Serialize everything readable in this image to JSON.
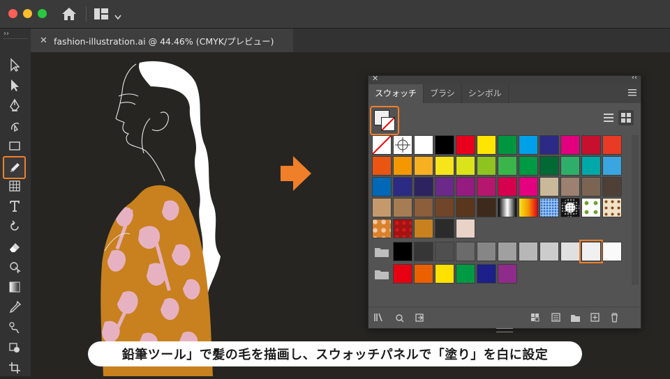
{
  "window": {
    "traffic_lights": {
      "close": "#ff5f57",
      "minimize": "#febc2e",
      "zoom": "#28c840"
    },
    "icons": [
      "home-icon",
      "workspace-layout-icon",
      "chevron-down-icon"
    ]
  },
  "document_tab": {
    "close_label": "✕",
    "title": "fashion-illustration.ai @ 44.46% (CMYK/プレビュー)"
  },
  "toolbar": {
    "collapse_label": "››",
    "tools": [
      "selection-tool",
      "direct-selection-tool",
      "pen-tool",
      "curvature-tool",
      "rectangle-tool",
      "pencil-tool",
      "artboard-grid-tool",
      "type-tool",
      "rotate-tool",
      "eraser-tool",
      "shape-builder-tool",
      "gradient-tool",
      "eyedropper-tool",
      "blend-tool",
      "live-paint-tool",
      "crop-tool"
    ],
    "active_tool": "pencil-tool",
    "accent": "#f07f2a"
  },
  "swatches_panel": {
    "close_label": "✕",
    "collapse_label": "‹‹",
    "tabs": [
      {
        "label": "スウォッチ",
        "active": true
      },
      {
        "label": "ブラシ",
        "active": false
      },
      {
        "label": "シンボル",
        "active": false
      }
    ],
    "menu_icon": "panel-menu-icon",
    "view_modes": [
      "list-view-icon",
      "thumbnail-view-icon"
    ],
    "fill_color": "#efefef",
    "rows": [
      [
        "none",
        "registration",
        "#ffffff",
        "#000000",
        "#e8001c",
        "#ffe500",
        "#00963f",
        "#00a0e9",
        "#2b2a87",
        "#e3007f",
        "#c7102e",
        "#e83a27"
      ],
      [
        "#ea5513",
        "#f39800",
        "#f5b122",
        "#f6e51b",
        "#dbe31b",
        "#8fc31f",
        "#3ab54a",
        "#009944",
        "#006934",
        "#2fae6a",
        "#00a9a7",
        "#3aa5de"
      ],
      [
        "#0068b7",
        "#2b2b83",
        "#2e2361",
        "#6b2a89",
        "#951b81",
        "#b4176d",
        "#d7004f",
        "#e4007f",
        "#c9b89a",
        "#9c8170",
        "#7b6552",
        "#4f4037"
      ],
      [
        "#c49a6c",
        "#a67c52",
        "#8b5e3c",
        "#704628",
        "#5a361c",
        "#3e2a1a",
        "grad-bw",
        "grad-orange",
        "grad-blue-dots",
        "pattern-dots",
        "pattern-leaf",
        "pattern-swirl"
      ],
      [
        "pattern-orange-floral",
        "pattern-red-floral",
        "#c8811e",
        "#2b2b2b",
        "#e9d2c8"
      ]
    ],
    "gray_group": [
      "#000000",
      "#363636",
      "#4f4f4f",
      "#6b6b6b",
      "#868686",
      "#a0a0a0",
      "#b7b7b7",
      "#cccccc",
      "#e0e0e0",
      "#f0f0f0",
      "#fafafa"
    ],
    "gray_selected_index": 9,
    "brights_group": [
      "#e60012",
      "#eb6100",
      "#ffe100",
      "#009944",
      "#1d2088",
      "#8f2b8a"
    ],
    "bottom_icons": [
      "swatch-libraries-icon",
      "place-swatches-icon",
      "show-kinds-icon",
      "swatch-options-icon",
      "color-group-icon",
      "new-color-group-icon",
      "new-swatch-icon",
      "delete-swatch-icon"
    ]
  },
  "artwork": {
    "dress_color": "#c8811e",
    "pattern_color": "#e6b2c2",
    "hair_color": "#ffffff",
    "arrow_color": "#f07f2a"
  },
  "caption": "鉛筆ツール」で髪の毛を描画し、スウォッチパネルで「塗り」を白に設定"
}
